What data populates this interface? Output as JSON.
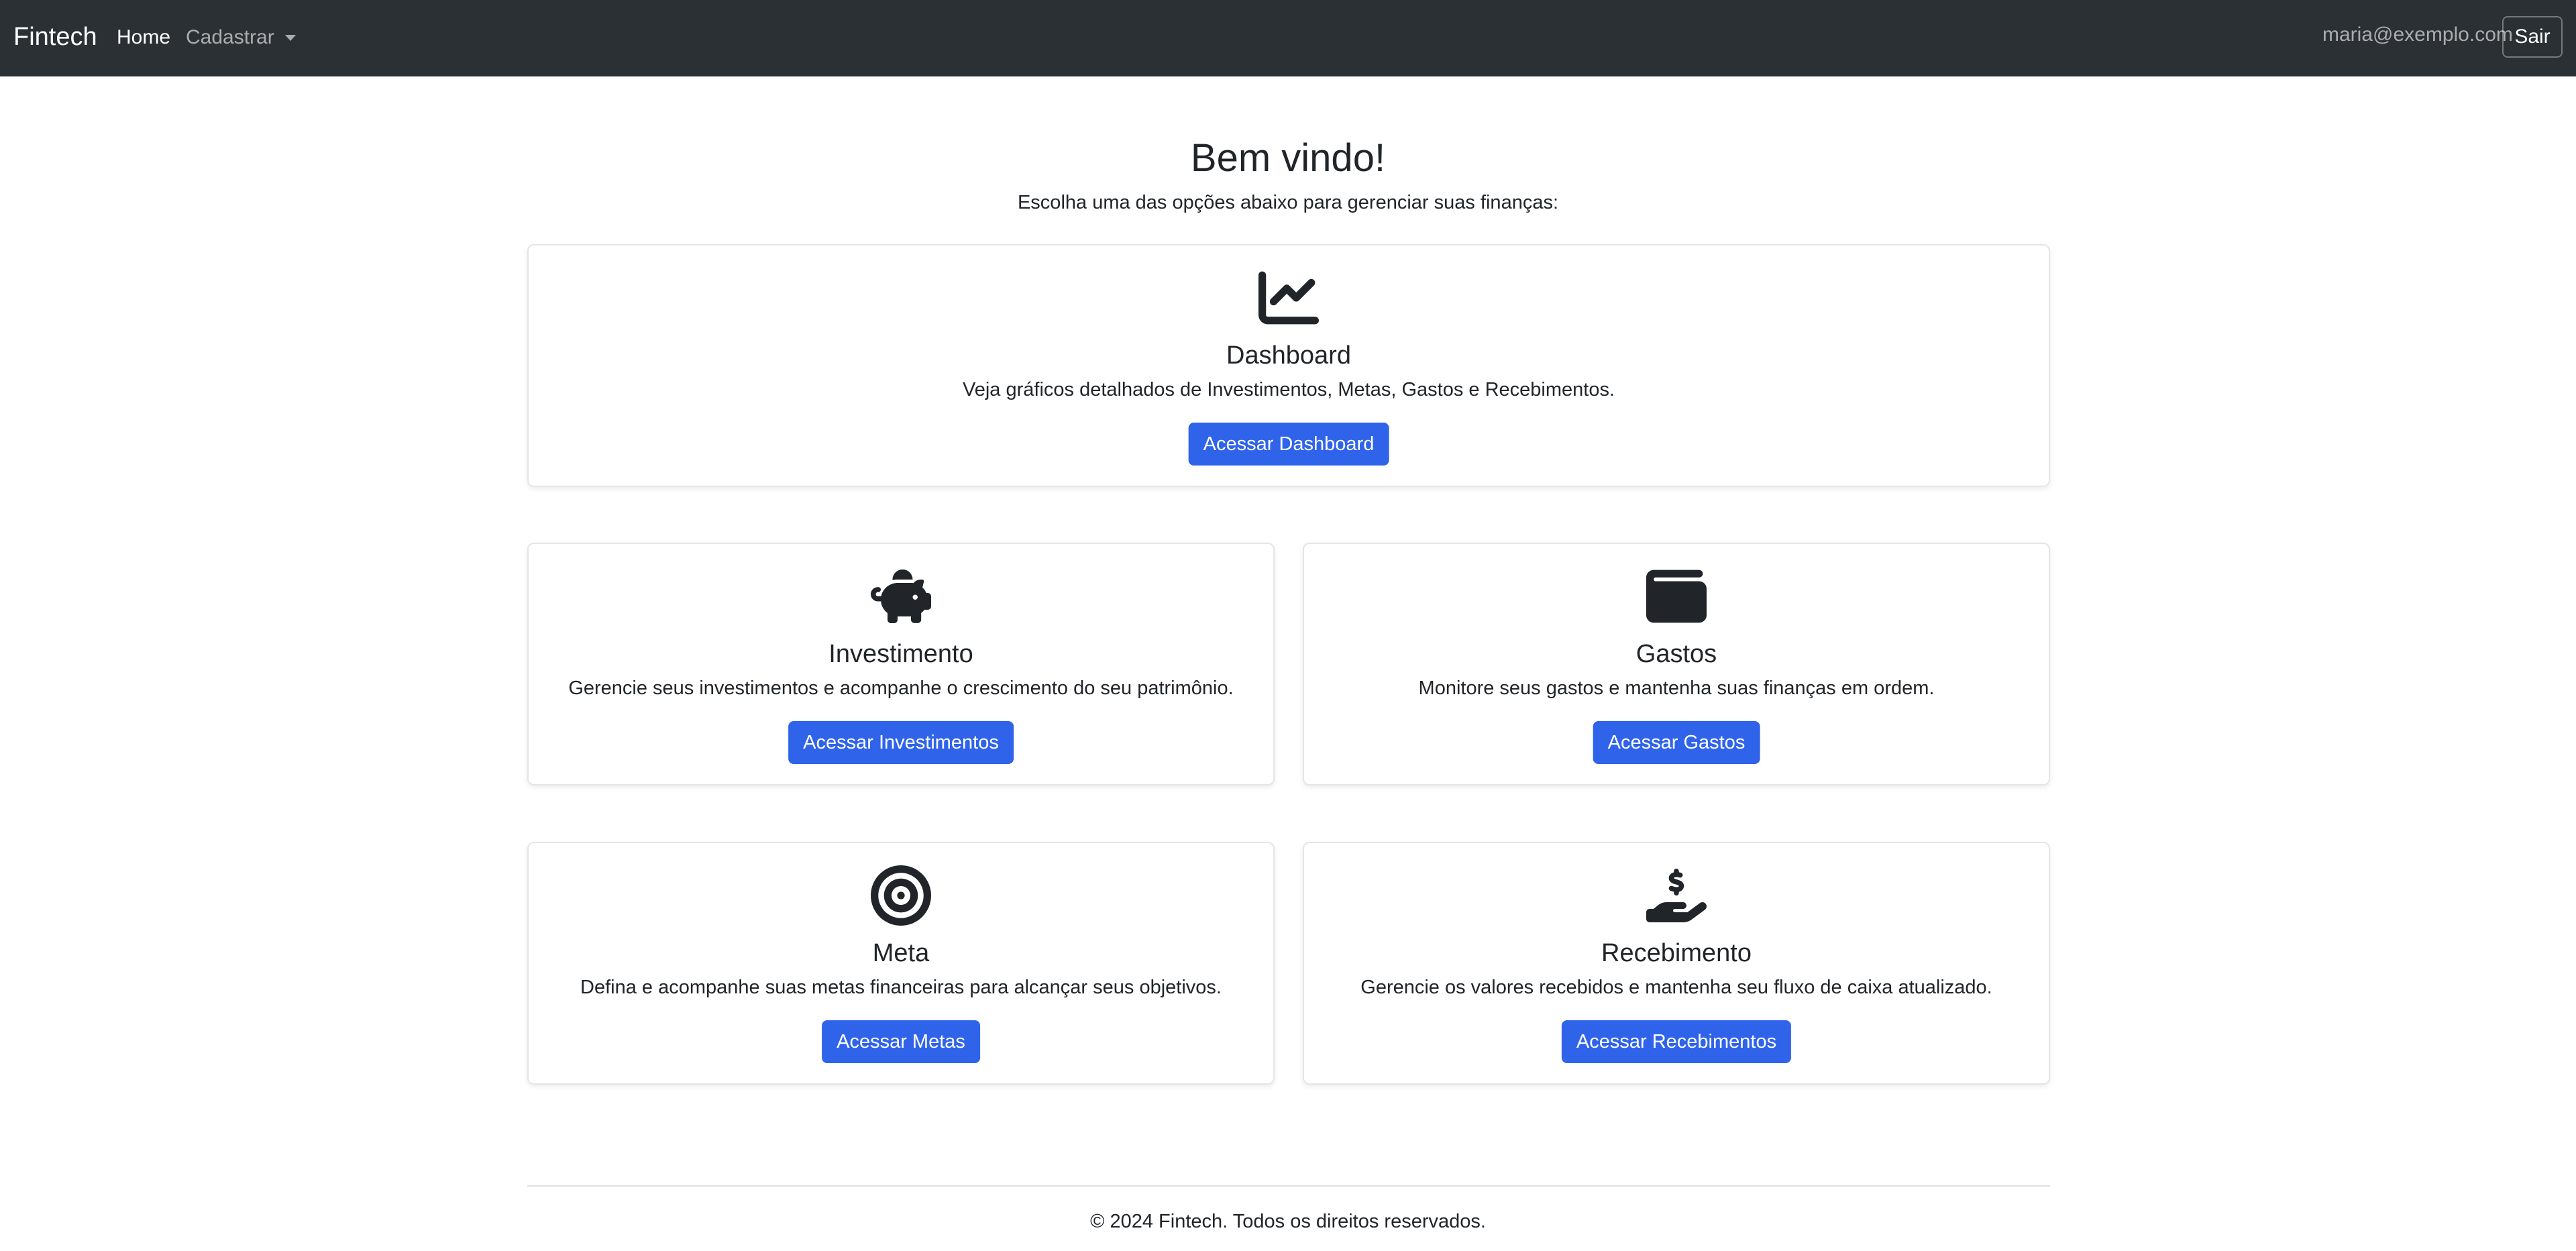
{
  "navbar": {
    "brand": "Fintech",
    "home": "Home",
    "cadastrar": "Cadastrar",
    "user_email": "maria@exemplo.com",
    "logout": "Sair"
  },
  "header": {
    "title": "Bem vindo!",
    "subtitle": "Escolha uma das opções abaixo para gerenciar suas finanças:"
  },
  "cards": {
    "dashboard": {
      "icon": "chart-line-icon",
      "title": "Dashboard",
      "text": "Veja gráficos detalhados de Investimentos, Metas, Gastos e Recebimentos.",
      "button": "Acessar Dashboard"
    },
    "investimento": {
      "icon": "piggy-bank-icon",
      "title": "Investimento",
      "text": "Gerencie seus investimentos e acompanhe o crescimento do seu patrimônio.",
      "button": "Acessar Investimentos"
    },
    "gastos": {
      "icon": "wallet-icon",
      "title": "Gastos",
      "text": "Monitore seus gastos e mantenha suas finanças em ordem.",
      "button": "Acessar Gastos"
    },
    "meta": {
      "icon": "target-icon",
      "title": "Meta",
      "text": "Defina e acompanhe suas metas financeiras para alcançar seus objetivos.",
      "button": "Acessar Metas"
    },
    "recebimento": {
      "icon": "hand-dollar-icon",
      "title": "Recebimento",
      "text": "Gerencie os valores recebidos e mantenha seu fluxo de caixa atualizado.",
      "button": "Acessar Recebimentos"
    }
  },
  "footer": {
    "text": "© 2024 Fintech. Todos os direitos reservados."
  },
  "colors": {
    "navbar_bg": "#2b3035",
    "primary_button": "#2f63ea",
    "text": "#212529"
  }
}
